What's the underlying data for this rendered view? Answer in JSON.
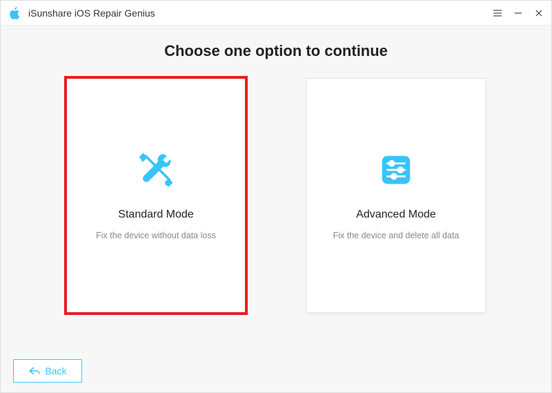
{
  "titlebar": {
    "app_name": "iSunshare iOS Repair Genius"
  },
  "heading": "Choose one option to continue",
  "cards": {
    "standard": {
      "title": "Standard Mode",
      "desc": "Fix the device without data loss",
      "selected": true
    },
    "advanced": {
      "title": "Advanced Mode",
      "desc": "Fix the device and delete all data",
      "selected": false
    }
  },
  "buttons": {
    "back": "Back"
  },
  "colors": {
    "accent": "#38c4fa",
    "highlight_border": "#e81e1e"
  }
}
